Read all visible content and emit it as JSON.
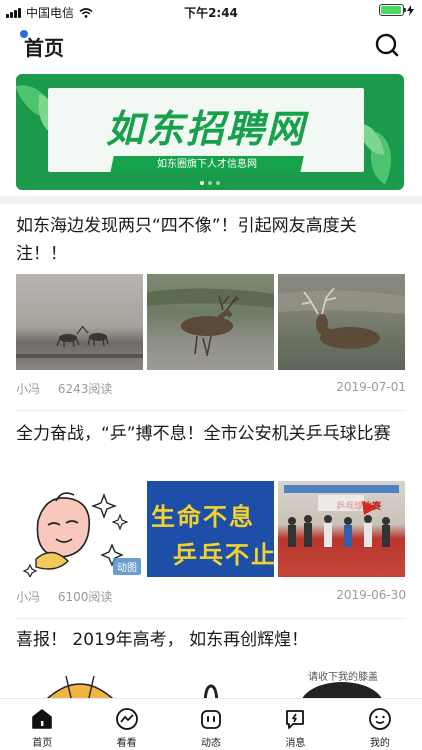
{
  "status_bar": {
    "carrier": "中国电信",
    "time": "下午2:44",
    "battery_level": 0.95
  },
  "header": {
    "title": "首页"
  },
  "banner": {
    "title": "如东招聘网",
    "subtitle": "如东圈旗下人才信息网"
  },
  "articles": [
    {
      "title": "如东海边发现两只“四不像”！引起网友高度关注！！",
      "author": "小冯",
      "reads": "6243阅读",
      "date": "2019-07-01"
    },
    {
      "title": "全力奋战，“乒”搏不息！全市公安机关乒乓球比赛",
      "author": "小冯",
      "reads": "6100阅读",
      "date": "2019-06-30",
      "badge": "动图",
      "thumb_text_1": "生命不息",
      "thumb_text_2": "乒乓不止",
      "thumb_text_3": "乒乓球比赛"
    },
    {
      "title": "喜报！ 2019年高考， 如东再创辉煌！",
      "thumb_text": "请收下我的膝盖"
    }
  ],
  "tabs": [
    {
      "label": "首页",
      "icon": "home-icon"
    },
    {
      "label": "看看",
      "icon": "trend-icon"
    },
    {
      "label": "动态",
      "icon": "robot-icon"
    },
    {
      "label": "消息",
      "icon": "message-icon"
    },
    {
      "label": "我的",
      "icon": "smile-icon"
    }
  ],
  "colors": {
    "brand_green": "#16a14b",
    "accent_blue": "#2f6de1",
    "battery_green": "#4cd964"
  }
}
